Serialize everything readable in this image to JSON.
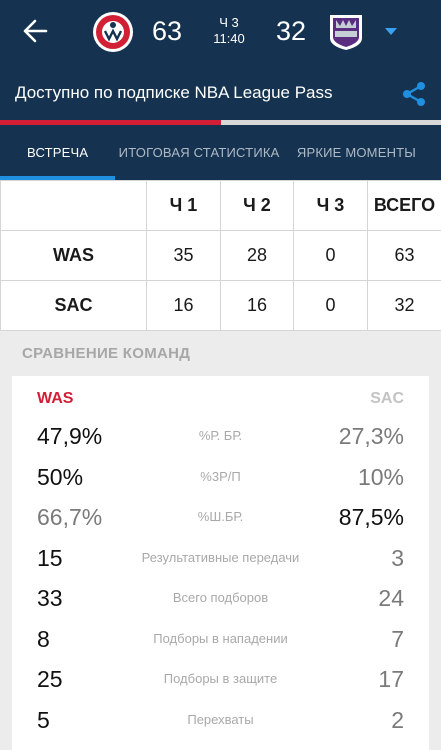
{
  "header": {
    "home_score": "63",
    "away_score": "32",
    "period": "Ч 3",
    "clock": "11:40"
  },
  "banner": {
    "text": "Доступно по подписке NBA League Pass",
    "progress_fraction": 0.5
  },
  "tabs": [
    {
      "label": "ВСТРЕЧА",
      "active": true
    },
    {
      "label": "ИТОГОВАЯ СТАТИСТИКА",
      "active": false
    },
    {
      "label": "ЯРКИЕ МОМЕНТЫ",
      "active": false
    }
  ],
  "boxscore": {
    "headers": [
      "",
      "Ч 1",
      "Ч 2",
      "Ч 3",
      "ВСЕГО"
    ],
    "rows": [
      {
        "team": "WAS",
        "q1": "35",
        "q2": "28",
        "q3": "0",
        "total": "63"
      },
      {
        "team": "SAC",
        "q1": "16",
        "q2": "16",
        "q3": "0",
        "total": "32"
      }
    ]
  },
  "comparison": {
    "title": "СРАВНЕНИЕ КОМАНД",
    "left_team": "WAS",
    "right_team": "SAC",
    "rows": [
      {
        "left": "47,9%",
        "label": "%Р. БР.",
        "right": "27,3%"
      },
      {
        "left": "50%",
        "label": "%3Р/П",
        "right": "10%"
      },
      {
        "left": "66,7%",
        "label": "%Ш.БР.",
        "right": "87,5%"
      },
      {
        "left": "15",
        "label": "Результативные передачи",
        "right": "3"
      },
      {
        "left": "33",
        "label": "Всего подборов",
        "right": "24"
      },
      {
        "left": "8",
        "label": "Подборы в нападении",
        "right": "7"
      },
      {
        "left": "25",
        "label": "Подборы в защите",
        "right": "17"
      },
      {
        "left": "5",
        "label": "Перехваты",
        "right": "2"
      }
    ]
  },
  "colors": {
    "header_bg": "#153350",
    "was_red": "#d31f36",
    "tab_indicator": "#1f8fe0",
    "share_blue": "#1f8fe0"
  }
}
